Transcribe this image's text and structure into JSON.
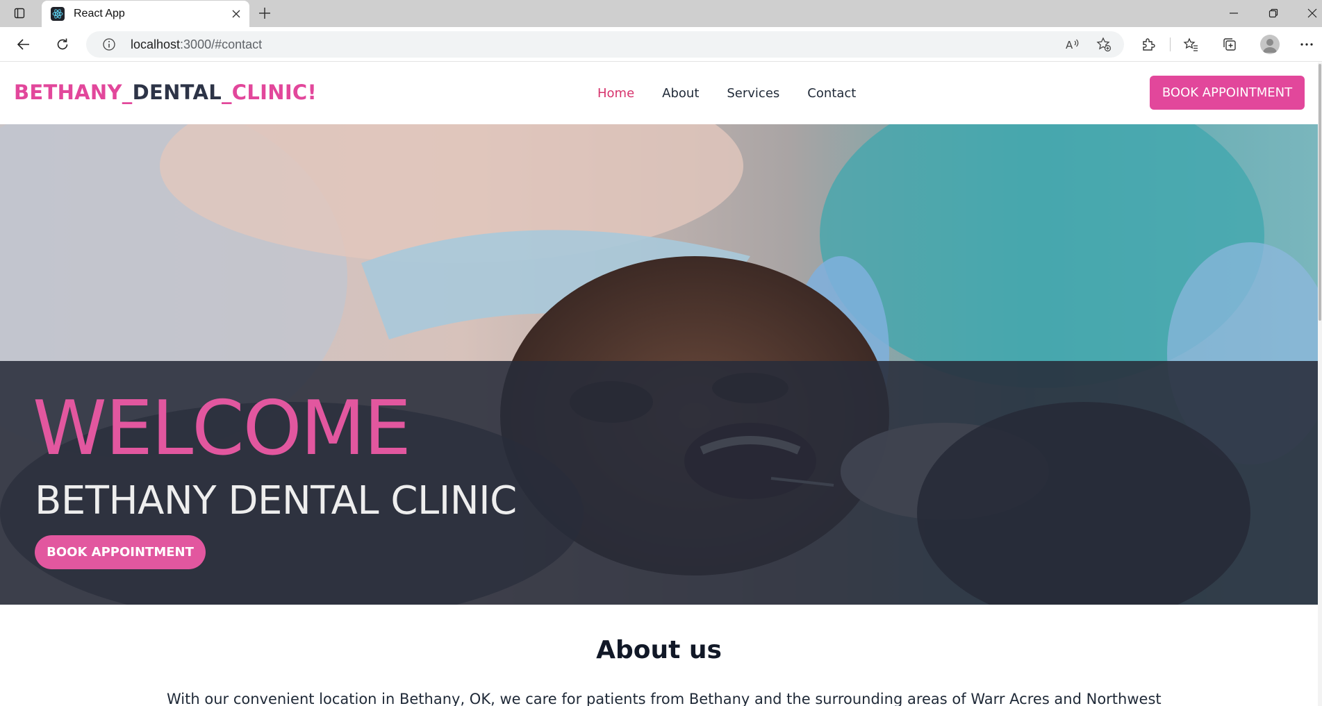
{
  "browser": {
    "tab_title": "React App",
    "address_host": "localhost",
    "address_path": ":3000/#contact",
    "icons": {
      "tab_actions": "tab-actions-icon",
      "favicon": "react-icon",
      "tab_close": "close-icon",
      "new_tab": "plus-icon",
      "minimize": "minimize-icon",
      "restore": "restore-icon",
      "close_window": "close-icon",
      "back": "back-arrow-icon",
      "refresh": "refresh-icon",
      "site_info": "info-icon",
      "read_aloud": "read-aloud-icon",
      "add_favorite": "star-plus-icon",
      "extensions": "puzzle-icon",
      "favorites": "favorites-icon",
      "collections": "collections-icon",
      "profile": "avatar-icon",
      "more": "more-icon"
    }
  },
  "site": {
    "logo_part1": "BETHANY_",
    "logo_part2": "DENTAL",
    "logo_part3": "_CLINIC!",
    "nav": [
      {
        "label": "Home",
        "active": true
      },
      {
        "label": "About",
        "active": false
      },
      {
        "label": "Services",
        "active": false
      },
      {
        "label": "Contact",
        "active": false
      }
    ],
    "header_cta": "BOOK APPOINTMENT",
    "colors": {
      "accent": "#e2479b",
      "dark": "#2d3447",
      "overlay": "#282c3a"
    }
  },
  "hero": {
    "welcome": "WELCOME",
    "subtitle": "BETHANY DENTAL CLINIC",
    "cta": "BOOK APPOINTMENT"
  },
  "about": {
    "title": "About us",
    "text": "With our convenient location in Bethany, OK, we care for patients from Bethany and the surrounding areas of Warr Acres and Northwest"
  }
}
